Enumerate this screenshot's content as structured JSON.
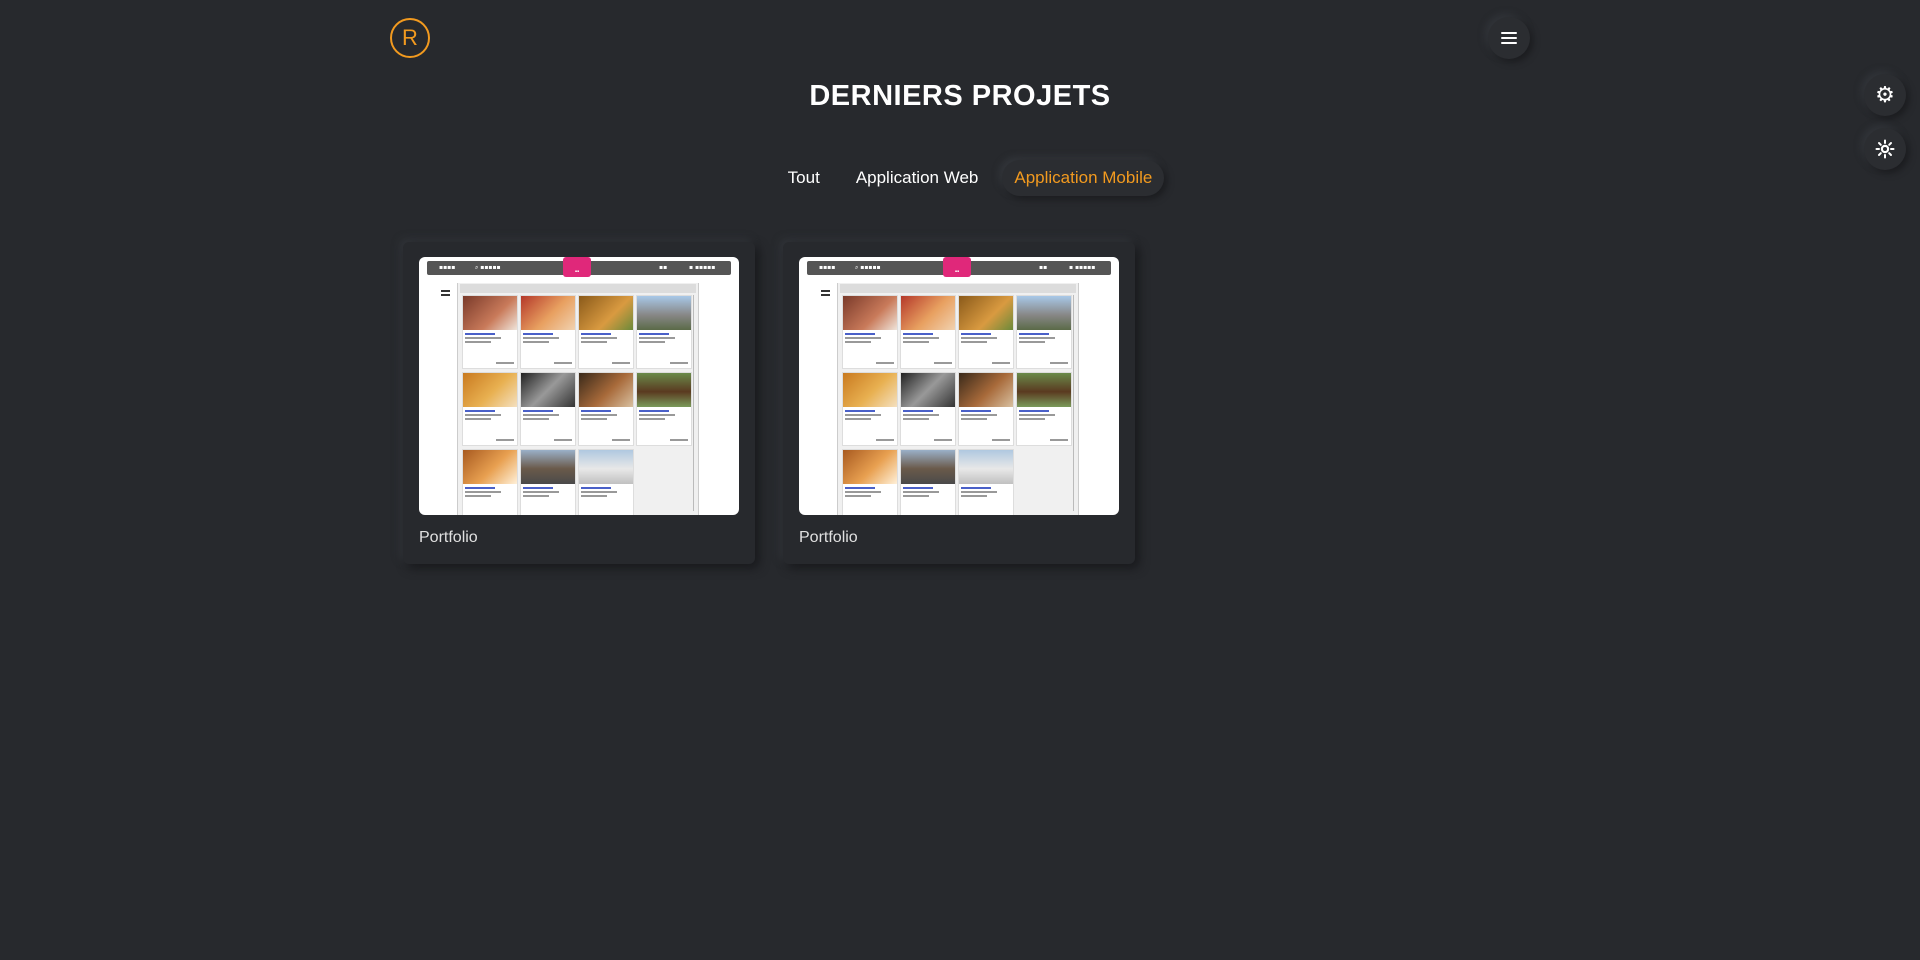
{
  "header": {
    "logo_letter": "R",
    "menu_icon": "hamburger-icon"
  },
  "side_controls": {
    "settings_icon": "gear-icon",
    "theme_icon": "sun-icon"
  },
  "section": {
    "title": "DERNIERS PROJETS"
  },
  "filters": {
    "tabs": [
      {
        "label": "Tout",
        "active": false
      },
      {
        "label": "Application Web",
        "active": false
      },
      {
        "label": "Application Mobile",
        "active": true
      }
    ]
  },
  "projects": [
    {
      "label": "Portfolio"
    },
    {
      "label": "Portfolio"
    }
  ],
  "colors": {
    "background": "#27292d",
    "accent": "#f29a1f",
    "text": "#ffffff"
  }
}
